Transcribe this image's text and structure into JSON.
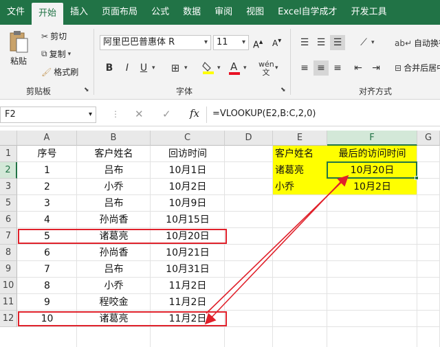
{
  "tabs": [
    {
      "label": "文件",
      "active": false
    },
    {
      "label": "开始",
      "active": true
    },
    {
      "label": "插入",
      "active": false
    },
    {
      "label": "页面布局",
      "active": false
    },
    {
      "label": "公式",
      "active": false
    },
    {
      "label": "数据",
      "active": false
    },
    {
      "label": "审阅",
      "active": false
    },
    {
      "label": "视图",
      "active": false
    },
    {
      "label": "Excel自学成才",
      "active": false
    },
    {
      "label": "开发工具",
      "active": false
    }
  ],
  "clipboard": {
    "paste": "粘贴",
    "cut": "剪切",
    "copy": "复制",
    "format_painter": "格式刷",
    "label": "剪贴板"
  },
  "font": {
    "name": "阿里巴巴普惠体 R",
    "size": "11",
    "bold": "B",
    "italic": "I",
    "underline": "U",
    "label": "字体",
    "font_color": "#e81123",
    "fill_color": "#ffff00"
  },
  "alignment": {
    "wrap": "自动换行",
    "merge": "合并后居中",
    "label": "对齐方式"
  },
  "formula_bar": {
    "name_box": "F2",
    "fx": "fx",
    "formula": "=VLOOKUP(E2,B:C,2,0)"
  },
  "columns": [
    "A",
    "B",
    "C",
    "D",
    "E",
    "F",
    "G"
  ],
  "rows": [
    "1",
    "2",
    "3",
    "4",
    "5",
    "6",
    "7",
    "8",
    "9",
    "10",
    "11",
    "12"
  ],
  "table": {
    "headers": [
      "序号",
      "客户姓名",
      "回访时间"
    ],
    "rows": [
      [
        "1",
        "吕布",
        "10月1日"
      ],
      [
        "2",
        "小乔",
        "10月2日"
      ],
      [
        "3",
        "吕布",
        "10月9日"
      ],
      [
        "4",
        "孙尚香",
        "10月15日"
      ],
      [
        "5",
        "诸葛亮",
        "10月20日"
      ],
      [
        "6",
        "孙尚香",
        "10月21日"
      ],
      [
        "7",
        "吕布",
        "10月31日"
      ],
      [
        "8",
        "小乔",
        "11月2日"
      ],
      [
        "9",
        "程咬金",
        "11月2日"
      ],
      [
        "10",
        "诸葛亮",
        "11月2日"
      ]
    ]
  },
  "lookup": {
    "header_name": "客户姓名",
    "header_time": "最后的访问时间",
    "rows": [
      [
        "诸葛亮",
        "10月20日"
      ],
      [
        "小乔",
        "10月2日"
      ]
    ]
  },
  "colors": {
    "accent": "#217346",
    "highlight": "#ffff00",
    "annotation": "#e0202a"
  }
}
